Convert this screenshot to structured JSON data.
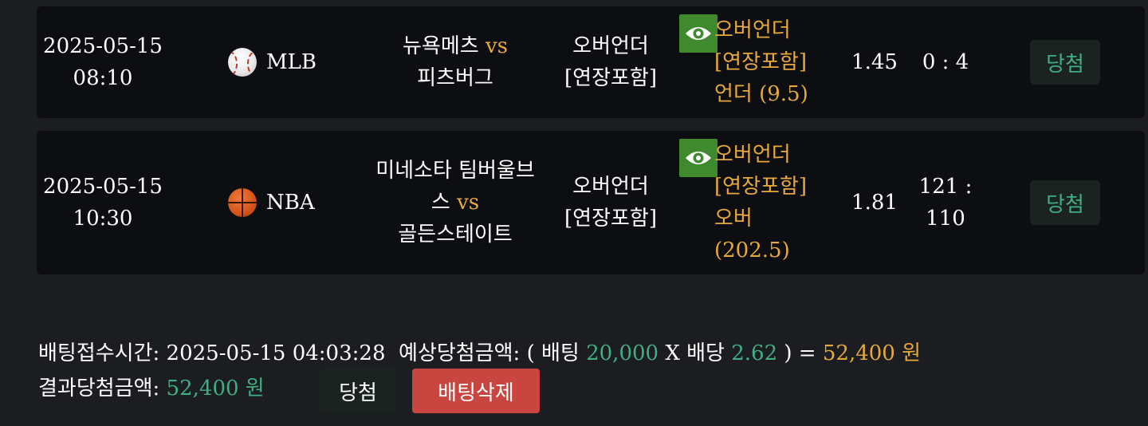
{
  "colors": {
    "accent_gold": "#e8a93c",
    "accent_green": "#3fae82",
    "danger": "#c9453f",
    "eye_button": "#3f8a2c"
  },
  "bets": [
    {
      "date": "2025-05-15",
      "time": "08:10",
      "league_icon": "baseball-icon",
      "league": "MLB",
      "home": "뉴욕메츠",
      "vs": "vs",
      "away": "피츠버그",
      "bet_type_line1": "오버언더",
      "bet_type_line2": "[연장포함]",
      "pick_line1": "오버언더",
      "pick_line2": "[연장포함]",
      "pick_line3": "언더 (9.5)",
      "odds": "1.45",
      "score": "0 : 4",
      "result": "당첨"
    },
    {
      "date": "2025-05-15",
      "time": "10:30",
      "league_icon": "basketball-icon",
      "league": "NBA",
      "home": "미네소타 팀버울브스",
      "vs": "vs",
      "away": "골든스테이트",
      "bet_type_line1": "오버언더",
      "bet_type_line2": "[연장포함]",
      "pick_line1": "오버언더",
      "pick_line2": "[연장포함]",
      "pick_line3": "오버",
      "pick_line4": "(202.5)",
      "odds": "1.81",
      "score": "121 : 110",
      "result": "당첨"
    }
  ],
  "summary": {
    "bet_time_label": "배팅접수시간:",
    "bet_time": "2025-05-15 04:03:28",
    "expected_label": "예상당첨금액: ( 배팅",
    "stake": "20,000",
    "x_label": "X 배당",
    "total_odds": "2.62",
    "equals": ") =",
    "expected_amount": "52,400 원",
    "result_label": "결과당첨금액:",
    "result_amount": "52,400 원",
    "result_button": "당첨",
    "delete_button": "배팅삭제"
  }
}
